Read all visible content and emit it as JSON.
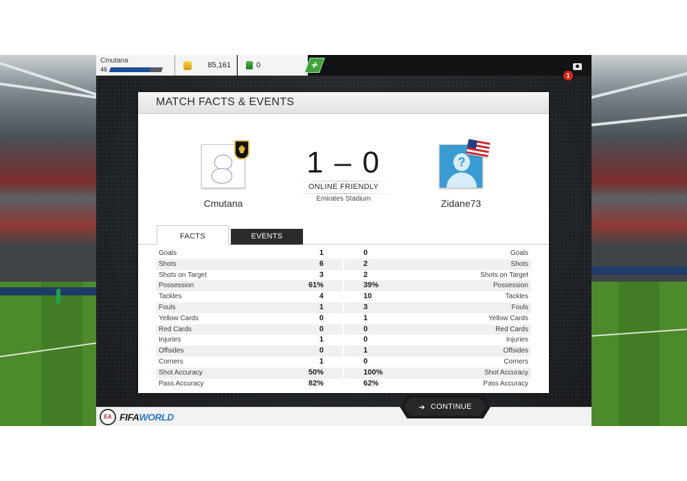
{
  "player": {
    "name": "Cmutana",
    "level": "46",
    "xp_fraction": 0.78
  },
  "currency": {
    "coins": "85,161",
    "points": "0",
    "add_label": "+"
  },
  "notifications": {
    "count": "1"
  },
  "card": {
    "title": "MATCH FACTS & EVENTS"
  },
  "match": {
    "home": {
      "name": "Cmutana"
    },
    "away": {
      "name": "Zidane73"
    },
    "score": "1 – 0",
    "type": "ONLINE FRIENDLY",
    "venue": "Emirates Stadium"
  },
  "tabs": [
    {
      "label": "FACTS",
      "active": true
    },
    {
      "label": "EVENTS",
      "active": false
    }
  ],
  "stats": [
    {
      "label": "Goals",
      "home": "1",
      "away": "0"
    },
    {
      "label": "Shots",
      "home": "6",
      "away": "2"
    },
    {
      "label": "Shots on Target",
      "home": "3",
      "away": "2"
    },
    {
      "label": "Possession",
      "home": "61%",
      "away": "39%"
    },
    {
      "label": "Tackles",
      "home": "4",
      "away": "10"
    },
    {
      "label": "Fouls",
      "home": "1",
      "away": "3"
    },
    {
      "label": "Yellow Cards",
      "home": "0",
      "away": "1"
    },
    {
      "label": "Red Cards",
      "home": "0",
      "away": "0"
    },
    {
      "label": "Injuries",
      "home": "1",
      "away": "0"
    },
    {
      "label": "Offsides",
      "home": "0",
      "away": "1"
    },
    {
      "label": "Corners",
      "home": "1",
      "away": "0"
    },
    {
      "label": "Shot Accuracy",
      "home": "50%",
      "away": "100%"
    },
    {
      "label": "Pass Accuracy",
      "home": "82%",
      "away": "62%"
    }
  ],
  "footer": {
    "logo_fifa": "FIFA",
    "logo_world": "WORLD",
    "continue_label": "CONTINUE"
  },
  "icons": {
    "coins": "coin-icon",
    "points": "fifa-points-icon",
    "camera": "camera-icon",
    "continue": "arrow-right-icon"
  },
  "colors": {
    "accent_green": "#3fa33a",
    "xp_blue": "#1d4f9b",
    "notif_red": "#d8261c"
  }
}
